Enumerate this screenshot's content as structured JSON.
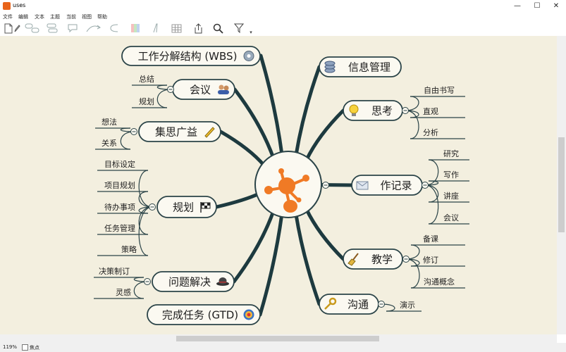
{
  "window": {
    "title": "uses",
    "minimize_glyph": "—",
    "maximize_glyph": "☐",
    "close_glyph": "✕"
  },
  "menu": [
    "文件",
    "编辑",
    "文本",
    "主题",
    "当前",
    "视图",
    "帮助"
  ],
  "toolbar_icons": [
    "new-document-icon",
    "pencil-icon",
    "topic-icon",
    "subtopic-icon",
    "callout-icon",
    "relationship-icon",
    "boundary-icon",
    "color-icon",
    "text-style-icon",
    "table-icon",
    "export-icon",
    "search-icon",
    "filter-icon"
  ],
  "colors": {
    "canvas_bg": "#f3efdf",
    "branch": "#1d3a3f",
    "node_fill": "#fbf9f1",
    "node_stroke": "#2b4448",
    "center_orange": "#f07a25"
  },
  "mindmap": {
    "center": {
      "icon": "orange-molecule-logo"
    },
    "branches": [
      {
        "id": "wbs",
        "label": "工作分解结构 (WBS)",
        "icon": "gear-icon",
        "children": []
      },
      {
        "id": "meeting",
        "label": "会议",
        "icon": "people-icon",
        "children": [
          "总结",
          "规划"
        ]
      },
      {
        "id": "brainstorm",
        "label": "集思广益",
        "icon": "pencil-icon",
        "children": [
          "想法",
          "关系"
        ]
      },
      {
        "id": "planning",
        "label": "规划",
        "icon": "checkered-flag-icon",
        "children": [
          "目标设定",
          "项目规划",
          "待办事项",
          "任务管理",
          "策略"
        ]
      },
      {
        "id": "problem",
        "label": "问题解决",
        "icon": "bowler-hat-icon",
        "children": [
          "决策制订",
          "灵感"
        ]
      },
      {
        "id": "gtd",
        "label": "完成任务 (GTD)",
        "icon": "target-icon",
        "children": []
      },
      {
        "id": "info",
        "label": "信息管理",
        "icon": "database-icon",
        "children": []
      },
      {
        "id": "thinking",
        "label": "思考",
        "icon": "lightbulb-icon",
        "children": [
          "自由书写",
          "直观",
          "分析"
        ]
      },
      {
        "id": "notes",
        "label": "作记录",
        "icon": "envelope-icon",
        "children": [
          "研究",
          "写作",
          "讲座",
          "会议"
        ]
      },
      {
        "id": "teaching",
        "label": "教学",
        "icon": "broom-icon",
        "children": [
          "备课",
          "修订",
          "沟通概念"
        ]
      },
      {
        "id": "communication",
        "label": "沟通",
        "icon": "key-icon",
        "children": [
          "演示"
        ]
      }
    ]
  },
  "status": {
    "zoom": "119%",
    "focus_label": "焦点",
    "focus_checked": false
  }
}
